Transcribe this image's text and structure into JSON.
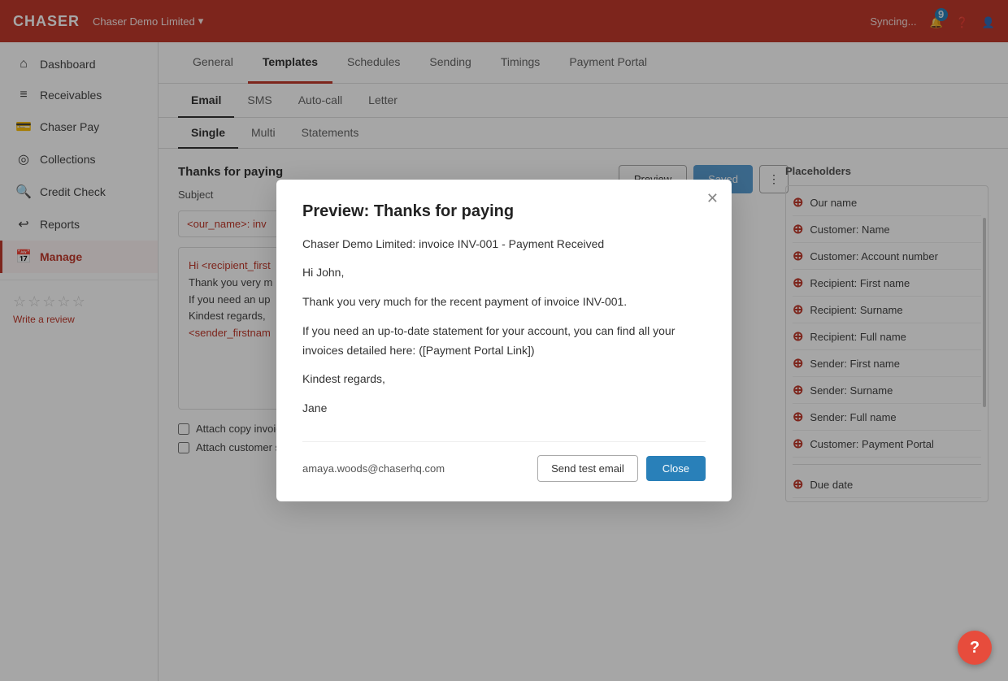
{
  "app": {
    "brand": "CHASER",
    "company": "Chaser Demo Limited",
    "company_dropdown": "▾",
    "syncing": "Syncing...",
    "notification_count": "9"
  },
  "sidebar": {
    "items": [
      {
        "id": "dashboard",
        "label": "Dashboard",
        "icon": "⌂"
      },
      {
        "id": "receivables",
        "label": "Receivables",
        "icon": "☰"
      },
      {
        "id": "chaser-pay",
        "label": "Chaser Pay",
        "icon": "💳"
      },
      {
        "id": "collections",
        "label": "Collections",
        "icon": "◎"
      },
      {
        "id": "credit-check",
        "label": "Credit Check",
        "icon": "🔍"
      },
      {
        "id": "reports",
        "label": "Reports",
        "icon": "↩"
      },
      {
        "id": "manage",
        "label": "Manage",
        "icon": "📅"
      }
    ],
    "review": {
      "stars": [
        "☆",
        "☆",
        "☆",
        "☆",
        "☆"
      ],
      "link_label": "Write a review"
    }
  },
  "top_tabs": [
    {
      "id": "general",
      "label": "General"
    },
    {
      "id": "templates",
      "label": "Templates",
      "active": true
    },
    {
      "id": "schedules",
      "label": "Schedules"
    },
    {
      "id": "sending",
      "label": "Sending"
    },
    {
      "id": "timings",
      "label": "Timings"
    },
    {
      "id": "payment-portal",
      "label": "Payment Portal"
    }
  ],
  "sub_tabs": [
    {
      "id": "email",
      "label": "Email",
      "active": true
    },
    {
      "id": "sms",
      "label": "SMS"
    },
    {
      "id": "auto-call",
      "label": "Auto-call"
    },
    {
      "id": "letter",
      "label": "Letter"
    }
  ],
  "third_tabs": [
    {
      "id": "single",
      "label": "Single",
      "active": true
    },
    {
      "id": "multi",
      "label": "Multi"
    },
    {
      "id": "statements",
      "label": "Statements"
    }
  ],
  "template": {
    "title": "Thanks for paying",
    "subject_label": "Subject",
    "subject_value": "<our_name>: inv",
    "body_lines": [
      "Hi <recipient_first",
      "Thank you very m",
      "If you need an up",
      "Kindest regards,",
      "<sender_firstnam"
    ],
    "preview_btn": "Preview",
    "saved_btn": "Saved",
    "more_btn": "⋮"
  },
  "actions_row": {
    "preview_label": "Preview",
    "saved_label": "Saved"
  },
  "placeholders": {
    "title": "Placeholders",
    "items": [
      {
        "id": "our-name",
        "label": "Our name"
      },
      {
        "id": "customer-name",
        "label": "Customer: Name"
      },
      {
        "id": "customer-account-number",
        "label": "Customer: Account number"
      },
      {
        "id": "recipient-first-name",
        "label": "Recipient: First name"
      },
      {
        "id": "recipient-surname",
        "label": "Recipient: Surname"
      },
      {
        "id": "recipient-full-name",
        "label": "Recipient: Full name"
      },
      {
        "id": "sender-first-name",
        "label": "Sender: First name"
      },
      {
        "id": "sender-surname",
        "label": "Sender: Surname"
      },
      {
        "id": "sender-full-name",
        "label": "Sender: Full name"
      },
      {
        "id": "customer-payment-portal",
        "label": "Customer: Payment Portal"
      },
      {
        "id": "due-date",
        "label": "Due date"
      }
    ]
  },
  "checkboxes": [
    {
      "id": "attach-copy-invoice",
      "label": "Attach copy invoice",
      "checked": false
    },
    {
      "id": "attach-customer-statement",
      "label": "Attach customer statement",
      "checked": false
    }
  ],
  "modal": {
    "title": "Preview: Thanks for paying",
    "email_header": "Chaser Demo Limited: invoice INV-001 - Payment Received",
    "greeting": "Hi John,",
    "body1": "Thank you very much for the recent payment of  invoice INV-001.",
    "body2": "If you need an up-to-date statement for your account, you can find all your invoices detailed here:  ([Payment Portal Link])",
    "sign_off": "Kindest regards,",
    "sender": "Jane",
    "test_email": "amaya.woods@chaserhq.com",
    "send_test_label": "Send test email",
    "close_label": "Close"
  },
  "help_btn": "?"
}
